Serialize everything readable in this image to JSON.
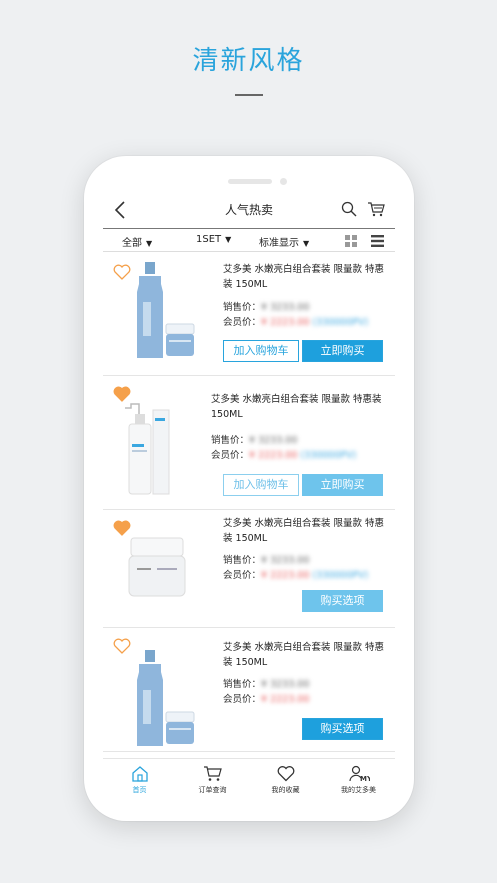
{
  "headline": "清新风格",
  "nav": {
    "title": "人气热卖"
  },
  "filters": {
    "category": "全部",
    "set": "1SET",
    "display": "标准显示"
  },
  "products": [
    {
      "name": "艾多美 水嫩亮白组合套装 限量款 特惠装 150ML",
      "sale_label": "销售价：",
      "sale_value": "¥ 3233.00",
      "member_label": "会员价：",
      "member_value": "¥ 2223.00",
      "pv": "(330000PV)",
      "favorited": false,
      "image": "blue-toner-set",
      "add_cart": "加入购物车",
      "buy_now": "立即购买"
    },
    {
      "name": "艾多美 水嫩亮白组合套装 限量款 特惠装 150ML",
      "sale_label": "销售价：",
      "sale_value": "¥ 3233.00",
      "member_label": "会员价：",
      "member_value": "¥ 2223.00",
      "pv": "(330000PV)",
      "favorited": true,
      "image": "pump-bottle",
      "add_cart": "加入购物车",
      "buy_now": "立即购买"
    },
    {
      "name": "艾多美 水嫩亮白组合套装 限量款 特惠装 150ML",
      "sale_label": "销售价：",
      "sale_value": "¥ 3233.00",
      "member_label": "会员价：",
      "member_value": "¥ 2223.00",
      "pv": "(330000PV)",
      "favorited": true,
      "image": "cream-jar",
      "buy_options": "购买选项"
    },
    {
      "name": "艾多美 水嫩亮白组合套装 限量款 特惠装 150ML",
      "sale_label": "销售价：",
      "sale_value": "¥ 3233.00",
      "member_label": "会员价：",
      "member_value": "¥ 2223.00",
      "favorited": false,
      "image": "blue-toner-set",
      "buy_options": "购买选项"
    }
  ],
  "tabs": [
    {
      "label": "首页",
      "icon": "home-icon",
      "active": true
    },
    {
      "label": "订单查询",
      "icon": "cart-icon",
      "active": false
    },
    {
      "label": "我的收藏",
      "icon": "heart-icon",
      "active": false
    },
    {
      "label": "我的艾多美",
      "icon": "profile-my-icon",
      "active": false
    }
  ],
  "colors": {
    "accent": "#1ea0dd",
    "heart": "#f5a04a",
    "price_red": "#e85a5a"
  }
}
